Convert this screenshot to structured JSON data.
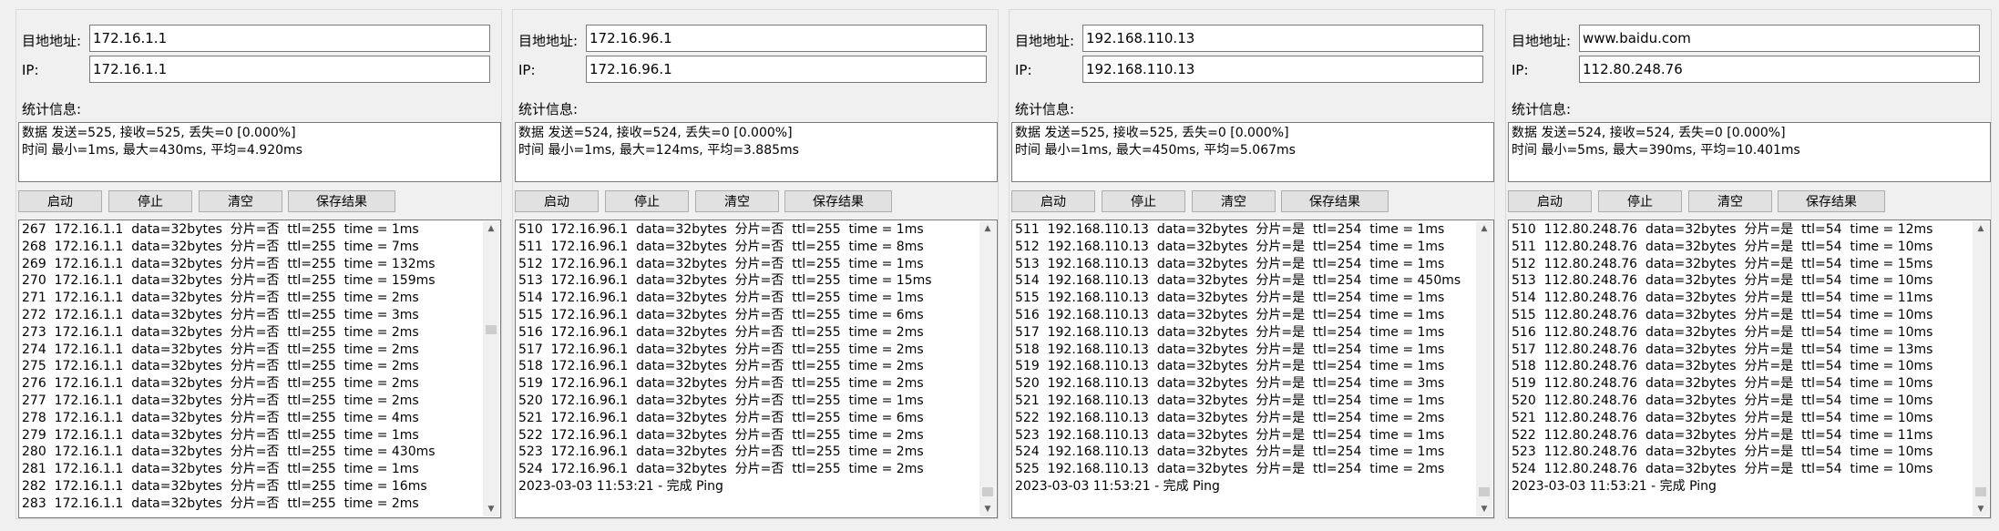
{
  "labels": {
    "target": "目地地址:",
    "ip": "IP:",
    "stats": "统计信息:",
    "start": "启动",
    "stop": "停止",
    "clear": "清空",
    "save": "保存结果"
  },
  "panels": [
    {
      "target": "172.16.1.1",
      "ip": "172.16.1.1",
      "stats_line1": "数据  发送=525,  接收=525,  丢失=0  [0.000%]",
      "stats_line2": "时间  最小=1ms,  最大=430ms,  平均=4.920ms",
      "log": [
        "267  172.16.1.1  data=32bytes  分片=否  ttl=255  time = 1ms",
        "268  172.16.1.1  data=32bytes  分片=否  ttl=255  time = 7ms",
        "269  172.16.1.1  data=32bytes  分片=否  ttl=255  time = 132ms",
        "270  172.16.1.1  data=32bytes  分片=否  ttl=255  time = 159ms",
        "271  172.16.1.1  data=32bytes  分片=否  ttl=255  time = 2ms",
        "272  172.16.1.1  data=32bytes  分片=否  ttl=255  time = 3ms",
        "273  172.16.1.1  data=32bytes  分片=否  ttl=255  time = 2ms",
        "274  172.16.1.1  data=32bytes  分片=否  ttl=255  time = 2ms",
        "275  172.16.1.1  data=32bytes  分片=否  ttl=255  time = 2ms",
        "276  172.16.1.1  data=32bytes  分片=否  ttl=255  time = 2ms",
        "277  172.16.1.1  data=32bytes  分片=否  ttl=255  time = 2ms",
        "278  172.16.1.1  data=32bytes  分片=否  ttl=255  time = 4ms",
        "279  172.16.1.1  data=32bytes  分片=否  ttl=255  time = 1ms",
        "280  172.16.1.1  data=32bytes  分片=否  ttl=255  time = 430ms",
        "281  172.16.1.1  data=32bytes  分片=否  ttl=255  time = 1ms",
        "282  172.16.1.1  data=32bytes  分片=否  ttl=255  time = 16ms",
        "283  172.16.1.1  data=32bytes  分片=否  ttl=255  time = 2ms"
      ]
    },
    {
      "target": "172.16.96.1",
      "ip": "172.16.96.1",
      "stats_line1": "数据  发送=524,  接收=524,  丢失=0  [0.000%]",
      "stats_line2": "时间  最小=1ms,  最大=124ms,  平均=3.885ms",
      "log": [
        "510  172.16.96.1  data=32bytes  分片=否  ttl=255  time = 1ms",
        "511  172.16.96.1  data=32bytes  分片=否  ttl=255  time = 8ms",
        "512  172.16.96.1  data=32bytes  分片=否  ttl=255  time = 1ms",
        "513  172.16.96.1  data=32bytes  分片=否  ttl=255  time = 15ms",
        "514  172.16.96.1  data=32bytes  分片=否  ttl=255  time = 1ms",
        "515  172.16.96.1  data=32bytes  分片=否  ttl=255  time = 6ms",
        "516  172.16.96.1  data=32bytes  分片=否  ttl=255  time = 2ms",
        "517  172.16.96.1  data=32bytes  分片=否  ttl=255  time = 2ms",
        "518  172.16.96.1  data=32bytes  分片=否  ttl=255  time = 2ms",
        "519  172.16.96.1  data=32bytes  分片=否  ttl=255  time = 2ms",
        "520  172.16.96.1  data=32bytes  分片=否  ttl=255  time = 1ms",
        "521  172.16.96.1  data=32bytes  分片=否  ttl=255  time = 6ms",
        "522  172.16.96.1  data=32bytes  分片=否  ttl=255  time = 2ms",
        "523  172.16.96.1  data=32bytes  分片=否  ttl=255  time = 2ms",
        "524  172.16.96.1  data=32bytes  分片=否  ttl=255  time = 2ms",
        "2023-03-03 11:53:21 - 完成 Ping"
      ]
    },
    {
      "target": "192.168.110.13",
      "ip": "192.168.110.13",
      "stats_line1": "数据  发送=525,  接收=525,  丢失=0  [0.000%]",
      "stats_line2": "时间  最小=1ms,  最大=450ms,  平均=5.067ms",
      "log": [
        "511  192.168.110.13  data=32bytes  分片=是  ttl=254  time = 1ms",
        "512  192.168.110.13  data=32bytes  分片=是  ttl=254  time = 1ms",
        "513  192.168.110.13  data=32bytes  分片=是  ttl=254  time = 1ms",
        "514  192.168.110.13  data=32bytes  分片=是  ttl=254  time = 450ms",
        "515  192.168.110.13  data=32bytes  分片=是  ttl=254  time = 1ms",
        "516  192.168.110.13  data=32bytes  分片=是  ttl=254  time = 1ms",
        "517  192.168.110.13  data=32bytes  分片=是  ttl=254  time = 1ms",
        "518  192.168.110.13  data=32bytes  分片=是  ttl=254  time = 1ms",
        "519  192.168.110.13  data=32bytes  分片=是  ttl=254  time = 1ms",
        "520  192.168.110.13  data=32bytes  分片=是  ttl=254  time = 3ms",
        "521  192.168.110.13  data=32bytes  分片=是  ttl=254  time = 1ms",
        "522  192.168.110.13  data=32bytes  分片=是  ttl=254  time = 2ms",
        "523  192.168.110.13  data=32bytes  分片=是  ttl=254  time = 1ms",
        "524  192.168.110.13  data=32bytes  分片=是  ttl=254  time = 1ms",
        "525  192.168.110.13  data=32bytes  分片=是  ttl=254  time = 2ms",
        "2023-03-03 11:53:21 - 完成 Ping"
      ]
    },
    {
      "target": "www.baidu.com",
      "ip": "112.80.248.76",
      "stats_line1": "数据  发送=524,  接收=524,  丢失=0  [0.000%]",
      "stats_line2": "时间  最小=5ms,  最大=390ms,  平均=10.401ms",
      "log": [
        "510  112.80.248.76  data=32bytes  分片=是  ttl=54  time = 12ms",
        "511  112.80.248.76  data=32bytes  分片=是  ttl=54  time = 10ms",
        "512  112.80.248.76  data=32bytes  分片=是  ttl=54  time = 15ms",
        "513  112.80.248.76  data=32bytes  分片=是  ttl=54  time = 10ms",
        "514  112.80.248.76  data=32bytes  分片=是  ttl=54  time = 11ms",
        "515  112.80.248.76  data=32bytes  分片=是  ttl=54  time = 10ms",
        "516  112.80.248.76  data=32bytes  分片=是  ttl=54  time = 10ms",
        "517  112.80.248.76  data=32bytes  分片=是  ttl=54  time = 13ms",
        "518  112.80.248.76  data=32bytes  分片=是  ttl=54  time = 10ms",
        "519  112.80.248.76  data=32bytes  分片=是  ttl=54  time = 10ms",
        "520  112.80.248.76  data=32bytes  分片=是  ttl=54  time = 10ms",
        "521  112.80.248.76  data=32bytes  分片=是  ttl=54  time = 10ms",
        "522  112.80.248.76  data=32bytes  分片=是  ttl=54  time = 11ms",
        "523  112.80.248.76  data=32bytes  分片=是  ttl=54  time = 10ms",
        "524  112.80.248.76  data=32bytes  分片=是  ttl=54  time = 10ms",
        "2023-03-03 11:53:21 - 完成 Ping"
      ]
    }
  ]
}
